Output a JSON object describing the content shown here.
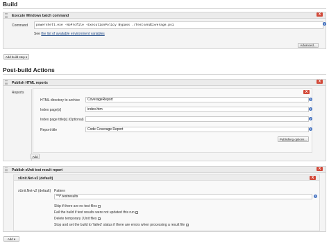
{
  "build": {
    "heading": "Build",
    "step": {
      "title": "Execute Windows batch command",
      "command_label": "Command",
      "command_value": "powershell.exe -NoProfile -ExecutionPolicy Bypass ./TestsAndCoverage.ps1",
      "see_prefix": "See",
      "see_link": "the list of available environment variables",
      "advanced_label": "Advanced...",
      "close_label": "X"
    },
    "add_button": "Add build step ▾"
  },
  "post_build": {
    "heading": "Post-build Actions",
    "html_reports": {
      "title": "Publish HTML reports",
      "reports_label": "Reports",
      "close_label": "X",
      "fields": [
        {
          "label": "HTML directory to archive",
          "value": "CoverageReport"
        },
        {
          "label": "Index page[s]",
          "value": "index.htm"
        },
        {
          "label": "Index page title[s] (Optional)",
          "value": ""
        },
        {
          "label": "Report title",
          "value": "Code Coverage Report"
        }
      ],
      "publishing_options": "Publishing options...",
      "add_label": "Add"
    },
    "xunit": {
      "title": "Publish xUnit test result report",
      "close_label": "X",
      "sub_title": "xUnit.Net-v2 (default)",
      "type_label": "xUnit.Net-v2 (default)",
      "pattern_label": "Pattern",
      "pattern_value": "**/*.testresults",
      "options": [
        {
          "label": "Skip if there are no test files",
          "checked": false
        },
        {
          "label": "Fail the build if test results were not updated this run",
          "checked": true
        },
        {
          "label": "Delete temporary JUnit files",
          "checked": true
        },
        {
          "label": "Stop and set the build to 'failed' status if there are errors when processing a result file",
          "checked": true
        }
      ]
    },
    "add_button": "Add ▾"
  },
  "help_glyph": "?",
  "colors": {
    "close": "#d24939",
    "help": "#3d6dbf",
    "link": "#204a87"
  }
}
